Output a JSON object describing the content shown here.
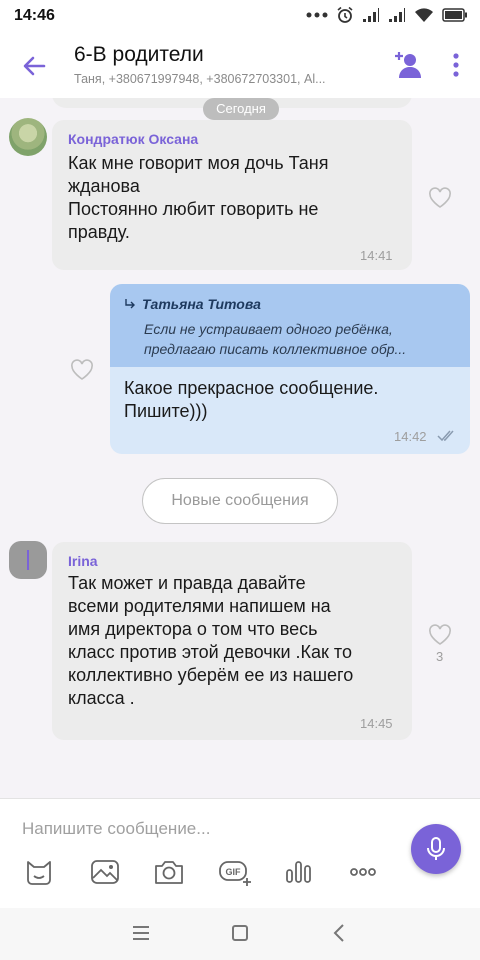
{
  "status_bar": {
    "time": "14:46",
    "icons": [
      "dots-icon",
      "alarm-icon",
      "signal-icon",
      "signal-icon",
      "wifi-icon",
      "battery-icon"
    ]
  },
  "header": {
    "title": "6-В родители",
    "subtitle": "Таня, +380671997948, +380672703301, Al..."
  },
  "chat": {
    "date_chip": "Сегодня",
    "messages": [
      {
        "sender": "Кондратюк Оксана",
        "text": "Как  мне говорит моя дочь Таня\nжданова\nПостоянно любит говорить не\nправду.",
        "time": "14:41"
      },
      {
        "quote_name": "Татьяна Титова",
        "quote_text": "Если не устраивает одного ребёнка,\nпредлагаю писать коллективное обр...",
        "text": "Какое прекрасное сообщение.\nПишите)))",
        "time": "14:42"
      },
      {
        "sender": "Irina",
        "text": "Так может и правда давайте\nвсеми родителями напишем на\nимя директора о том что весь\nкласс против этой девочки .Как то\nколлективно уберём ее из нашего\nкласса .",
        "time": "14:45",
        "likes": "3"
      }
    ],
    "new_messages_label": "Новые сообщения"
  },
  "compose": {
    "placeholder": "Напишите сообщение...",
    "tools": [
      "sticker-icon",
      "gallery-icon",
      "camera-icon",
      "gif-icon",
      "voice-wave-icon",
      "more-dots-icon"
    ]
  },
  "colors": {
    "accent": "#7a63d8",
    "incoming_bubble": "#ececec",
    "outgoing_bubble": "#d9e8f9",
    "quote_bg": "#a8c8f0",
    "chat_bg": "#f5f3f7"
  }
}
